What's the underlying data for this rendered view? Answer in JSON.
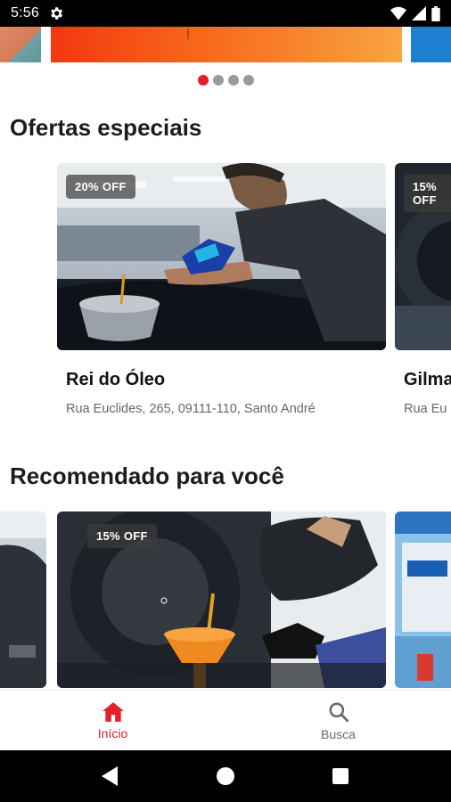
{
  "status_bar": {
    "time": "5:56",
    "icons": [
      "settings-icon",
      "wifi-icon",
      "signal-icon",
      "battery-icon"
    ]
  },
  "banner": {
    "pages": 4,
    "active_page": 0,
    "colors": {
      "main_start": "#f2380f",
      "main_end": "#f9a440",
      "right": "#1f7fd1"
    }
  },
  "sections": {
    "offers": {
      "title": "Ofertas especiais",
      "cards": [
        {
          "discount": "20% OFF",
          "name": "Rei do Óleo",
          "address": "Rua Euclides, 265, 09111-110, Santo André"
        },
        {
          "discount": "15% OFF",
          "name": "Gilma",
          "address": "Rua Eu"
        }
      ]
    },
    "recommended": {
      "title": "Recomendado para você",
      "cards": [
        {
          "discount": "15% OFF"
        }
      ]
    }
  },
  "bottom_nav": {
    "items": [
      {
        "label": "Início",
        "icon": "home-icon",
        "active": true
      },
      {
        "label": "Busca",
        "icon": "search-icon",
        "active": false
      }
    ]
  },
  "colors": {
    "accent": "#e4202a",
    "text": "#1c1c1c",
    "muted": "#666666"
  }
}
